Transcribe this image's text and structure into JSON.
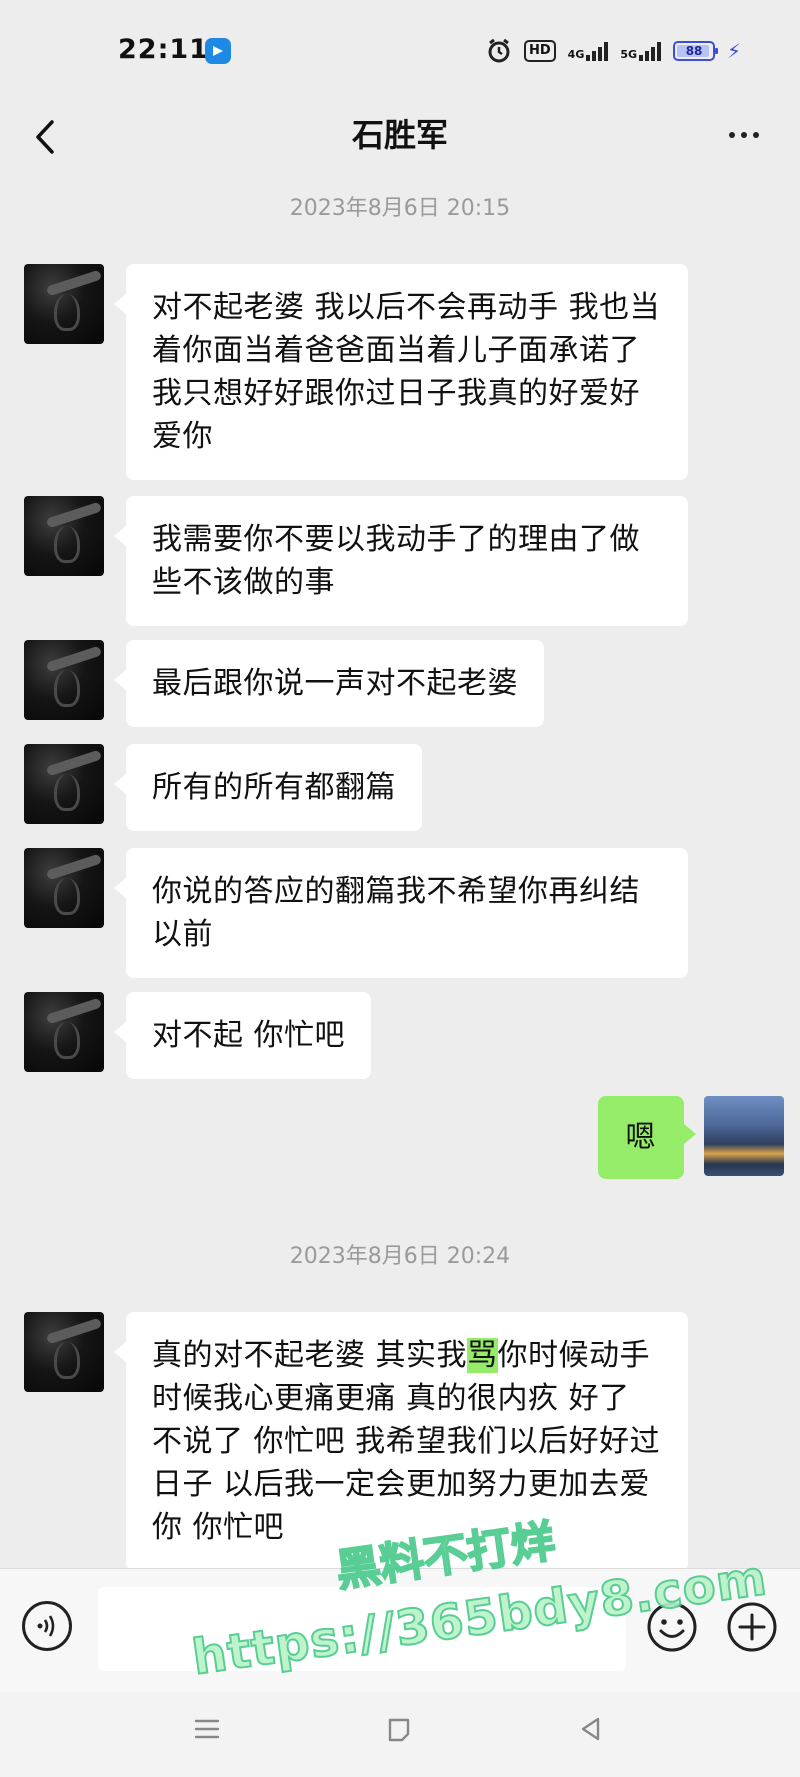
{
  "status_bar": {
    "time": "22:11",
    "hd": "HD",
    "net1": "4G",
    "net2": "5G",
    "battery": "88",
    "accent_color": "#3b4ed8"
  },
  "header": {
    "title": "石胜军",
    "back_icon": "chevron-left-icon",
    "more_icon": "more-dots-icon"
  },
  "chat": {
    "timestamp1": "2023年8月6日 20:15",
    "timestamp2": "2023年8月6日 20:24",
    "messages": [
      {
        "from": "contact",
        "text": "对不起老婆  我以后不会再动手  我也当着你面当着爸爸面当着儿子面承诺了  我只想好好跟你过日子我真的好爱好爱你"
      },
      {
        "from": "contact",
        "text": "我需要你不要以我动手了的理由了做些不该做的事"
      },
      {
        "from": "contact",
        "text": "最后跟你说一声对不起老婆"
      },
      {
        "from": "contact",
        "text": "所有的所有都翻篇"
      },
      {
        "from": "contact",
        "text": "你说的答应的翻篇我不希望你再纠结以前"
      },
      {
        "from": "contact",
        "text": "对不起  你忙吧"
      },
      {
        "from": "me",
        "text": "嗯"
      },
      {
        "from": "contact",
        "text_before": "真的对不起老婆  其实我",
        "text_highlight": "骂",
        "text_after": "你时候动手时候我心更痛更痛  真的很内疚  好了  不说了  你忙吧  我希望我们以后好好过日子  以后我一定会更加努力更加去爱你  你忙吧"
      }
    ]
  },
  "input_bar": {
    "voice_icon": "voice-icon",
    "emoji_icon": "emoji-icon",
    "plus_icon": "plus-icon",
    "input_value": ""
  },
  "nav_bar": {
    "menu_icon": "menu-icon",
    "home_icon": "home-icon",
    "back_icon": "back-triangle-icon"
  },
  "watermark": {
    "line1": "黑料不打烊",
    "line2": "https://365bdy8.com"
  },
  "colors": {
    "background": "#ededed",
    "my_bubble": "#95ec69",
    "their_bubble": "#ffffff"
  }
}
